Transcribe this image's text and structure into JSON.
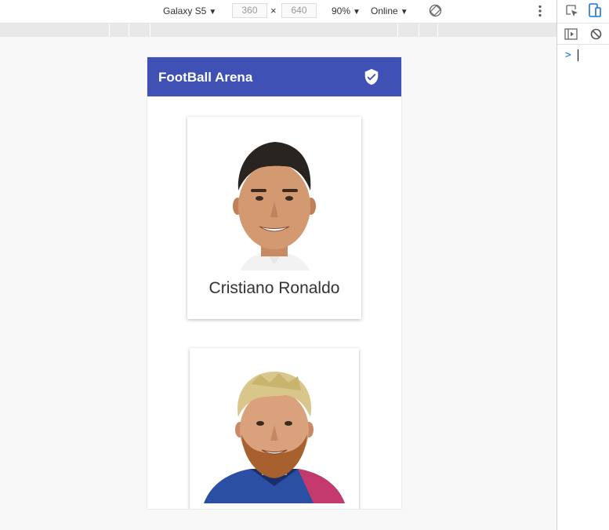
{
  "toolbar": {
    "device": "Galaxy S5",
    "width": "360",
    "times": "×",
    "height": "640",
    "zoom": "90%",
    "network": "Online"
  },
  "app": {
    "title": "FootBall Arena",
    "brand_color": "#3f51b5"
  },
  "players": [
    {
      "name": "Cristiano Ronaldo",
      "photo": "portrait-photo"
    },
    {
      "name": "",
      "photo": "portrait-photo"
    }
  ],
  "console": {
    "prompt": ">"
  }
}
